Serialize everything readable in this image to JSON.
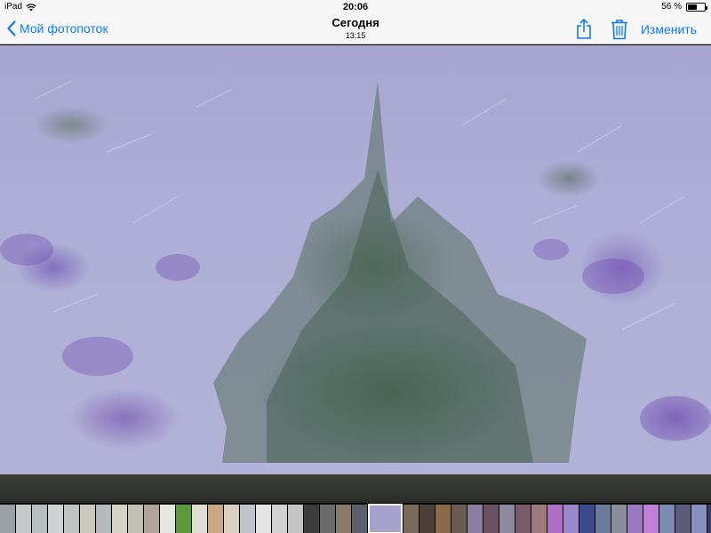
{
  "status_bar": {
    "device": "iPad",
    "time": "20:06",
    "battery_text": "56 %",
    "battery_level": 0.56
  },
  "nav": {
    "back_label": "Мой фотопоток",
    "title": "Сегодня",
    "subtitle": "13:15",
    "edit_label": "Изменить"
  },
  "icons": {
    "back": "chevron-left-icon",
    "share": "share-icon",
    "trash": "trash-icon"
  },
  "colors": {
    "accent": "#0a7aff",
    "bar_bg": "#f7f7f7"
  },
  "filmstrip": {
    "thumbnails": [
      "#9aa2a6",
      "#c5c9ca",
      "#b8bdbf",
      "#cfd2d1",
      "#bfc3c2",
      "#c9c7be",
      "#b4b9bb",
      "#d5d2c8",
      "#c2c0b5",
      "#b0a59a",
      "#e8e6e0",
      "#5a9a3a",
      "#e0ddd5",
      "#c8a882",
      "#d8cfc0",
      "#c0c4c8",
      "#e4e4e4",
      "#d2d2d2",
      "#c4c4c4",
      "#3b3b3b",
      "#6b6b6b",
      "#8a7a6a",
      "#5a5f6a",
      "#a6a4cf",
      "#7a6a5a",
      "#4a4038",
      "#8a6a4a",
      "#6a5a50",
      "#8a7ea0",
      "#6a5060",
      "#8e8aa0",
      "#7a5a6a",
      "#9a7a7a",
      "#b070c8",
      "#9a88c8",
      "#3a4a8a",
      "#6a7a9a",
      "#8a8e9a",
      "#9a7ac0",
      "#c080d8",
      "#7a8ab0",
      "#5a5a7a",
      "#8a90c0",
      "#3a3a5a"
    ],
    "active_index": 23
  }
}
